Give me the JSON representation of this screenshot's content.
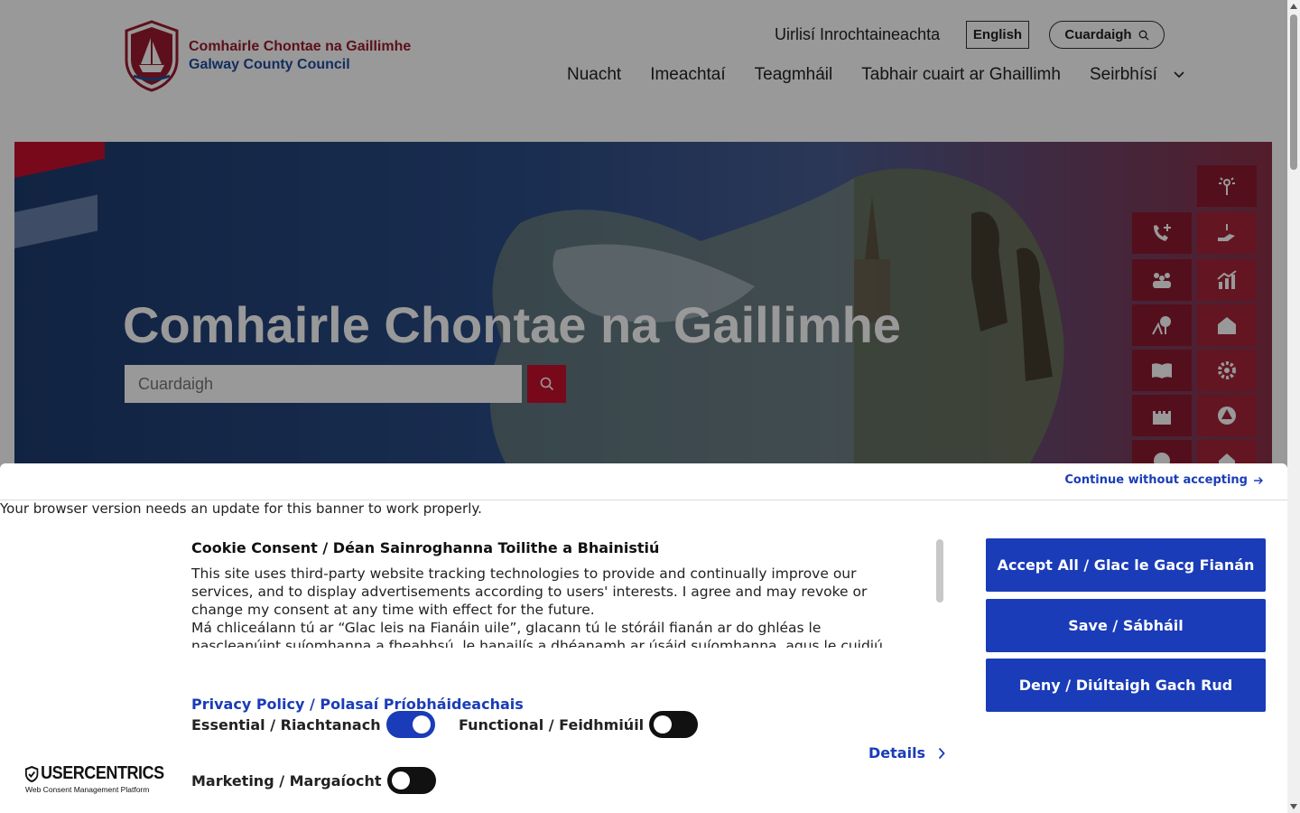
{
  "header": {
    "logo_ga": "Comhairle Chontae na Gaillimhe",
    "logo_en": "Galway County Council",
    "accessibility_link": "Uirlisí Inrochtaineachta",
    "language_button": "English",
    "search_button": "Cuardaigh",
    "nav": [
      {
        "label": "Nuacht"
      },
      {
        "label": "Imeachtaí"
      },
      {
        "label": "Teagmháil"
      },
      {
        "label": "Tabhair cuairt ar Ghaillimh"
      },
      {
        "label": "Seirbhísí"
      }
    ]
  },
  "hero": {
    "title": "Comhairle Chontae na Gaillimhe",
    "search_placeholder": "Cuardaigh"
  },
  "consent": {
    "continue_link": "Continue without accepting",
    "browser_message": "Your browser version needs an update for this banner to work properly.",
    "title": "Cookie Consent / Déan Sainroghanna Toilithe a Bhainistiú",
    "body_en": "This site uses third-party website tracking technologies to provide and continually improve our services, and to display advertisements according to users' interests. I agree and may revoke or change my consent at any time with effect for the future.",
    "body_ga": "Má chliceálann tú ar “Glac leis na Fianáin uile”, glacann tú le stóráil fianán ar do ghléas le nascleanúint suíomhanna a fheabhsú, le hanailís a dhéanamh ar úsáid suíomhanna, agus le cuidiú",
    "privacy_link": "Privacy Policy / Polasaí Príobháideachais",
    "toggles": {
      "essential": {
        "label": "Essential / Riachtanach",
        "state": "on"
      },
      "functional": {
        "label": "Functional / Feidhmiúil",
        "state": "off"
      },
      "marketing": {
        "label": "Marketing / Margaíocht",
        "state": "off"
      }
    },
    "details_link": "Details",
    "buttons": {
      "accept": "Accept All / Glac le Gacg Fianán",
      "save": "Save / Sábháil",
      "deny": "Deny / Diúltaigh Gach Rud"
    },
    "branding": {
      "name": "USERCENTRICS",
      "tagline": "Web Consent Management Platform"
    }
  },
  "colors": {
    "brand_red": "#c8102e",
    "brand_blue": "#1f4e9e",
    "consent_blue": "#1a3cb8"
  }
}
